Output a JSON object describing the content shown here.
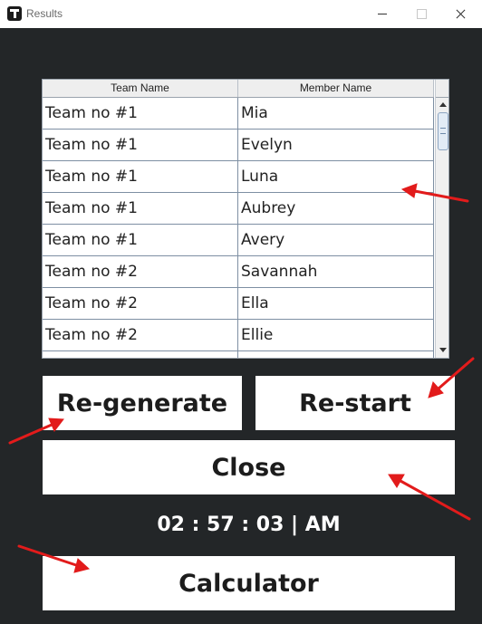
{
  "window": {
    "title": "Results",
    "icon": "app-t-icon"
  },
  "table": {
    "headers": [
      "Team Name",
      "Member Name"
    ],
    "rows": [
      [
        "Team no #1",
        "Mia"
      ],
      [
        "Team no #1",
        "Evelyn"
      ],
      [
        "Team no #1",
        "Luna"
      ],
      [
        "Team no #1",
        "Aubrey"
      ],
      [
        "Team no #1",
        "Avery"
      ],
      [
        "Team no #2",
        "Savannah"
      ],
      [
        "Team no #2",
        "Ella"
      ],
      [
        "Team no #2",
        "Ellie"
      ]
    ]
  },
  "buttons": {
    "regenerate": "Re-generate",
    "restart": "Re-start",
    "close": "Close",
    "calculator": "Calculator"
  },
  "clock": "02 : 57 : 03 | AM",
  "colors": {
    "background": "#232628",
    "button": "#ffffff",
    "annotation_arrow": "#e21b1b"
  }
}
